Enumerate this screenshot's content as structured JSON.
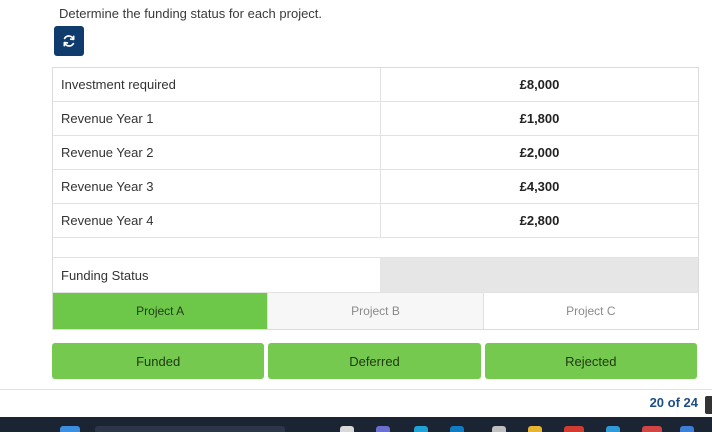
{
  "instruction": "Determine the funding status for each project.",
  "refresh_icon": "refresh-icon",
  "table": {
    "rows": [
      {
        "label": "Investment required",
        "value": "£8,000"
      },
      {
        "label": "Revenue Year 1",
        "value": "£1,800"
      },
      {
        "label": "Revenue Year 2",
        "value": "£2,000"
      },
      {
        "label": "Revenue Year 3",
        "value": "£4,300"
      },
      {
        "label": "Revenue Year 4",
        "value": "£2,800"
      }
    ],
    "status_label": "Funding Status"
  },
  "projects": [
    {
      "label": "Project A",
      "active": true
    },
    {
      "label": "Project B",
      "active": false
    },
    {
      "label": "Project C",
      "active": false
    }
  ],
  "options": [
    "Funded",
    "Deferred",
    "Rejected"
  ],
  "pagination": {
    "counter": "20 of 24"
  },
  "colors": {
    "accent_green": "#74c94e",
    "active_tab_green": "#6dc84a",
    "navy": "#0f3b6d",
    "counter_blue": "#1d4e86",
    "taskbar": "#1b2433"
  }
}
